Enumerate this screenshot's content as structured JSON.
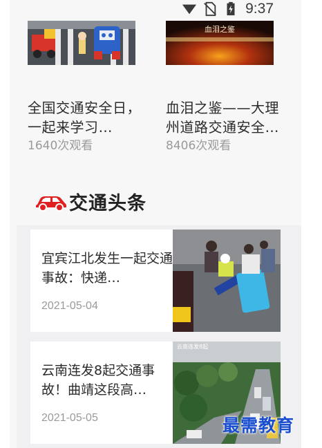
{
  "status_bar": {
    "time": "9:37",
    "icons": [
      "wifi-icon",
      "no-sim-icon",
      "battery-charging-icon"
    ]
  },
  "videos": [
    {
      "title": "全国交通安全日，一起来学习…",
      "views": "1640次观看",
      "thumb_icon": "toy-cars-crosswalk-image"
    },
    {
      "title": "血泪之鉴——大理州道路交通安全…",
      "views": "8406次观看",
      "thumb_icon": "fire-warning-banner-image",
      "thumb_caption": "血泪之鉴"
    }
  ],
  "section": {
    "title": "交通头条",
    "icon": "car-icon",
    "accent_color": "#e02020"
  },
  "news": [
    {
      "title": "宜宾江北发生一起交通事故：快递…",
      "date": "2021-05-04",
      "thumb_icon": "accident-scene-photo"
    },
    {
      "title": "云南连发8起交通事故！曲靖这段高…",
      "date": "2021-05-05",
      "thumb_icon": "highway-aerial-photo",
      "thumb_caption": "云南连发8起"
    }
  ],
  "watermark": "最需教育"
}
